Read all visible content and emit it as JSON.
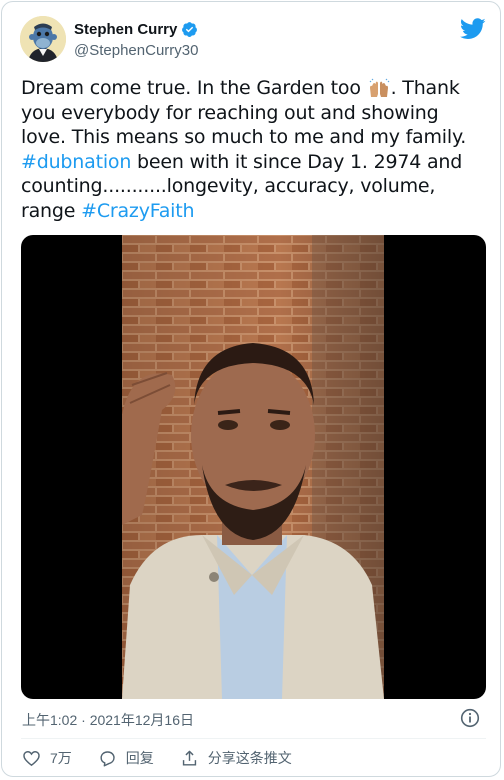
{
  "tweet": {
    "author_name": "Stephen Curry",
    "author_handle": "@StephenCurry30",
    "text_1": "Dream come true. In the Garden too ",
    "text_2": ". Thank you everybody for reaching out and showing love. This means so much to me and my family. ",
    "hashtag_1": "#dubnation",
    "text_3": " been with it since Day 1. 2974 and counting...........longevity, accuracy, volume, range ",
    "hashtag_2": "#CrazyFaith",
    "timestamp": "上午1:02 · 2021年12月16日"
  },
  "actions": {
    "like_count": "7万",
    "reply_label": "回复",
    "share_label": "分享这条推文"
  },
  "icons": {
    "brand": "twitter-bird-icon",
    "verified": "verified-badge-icon",
    "info": "info-icon",
    "like": "heart-icon",
    "reply": "speech-bubble-icon",
    "share": "share-icon"
  },
  "colors": {
    "link": "#1d9bf0",
    "text": "#0f1419",
    "muted": "#536471",
    "border": "#cfd9de"
  }
}
